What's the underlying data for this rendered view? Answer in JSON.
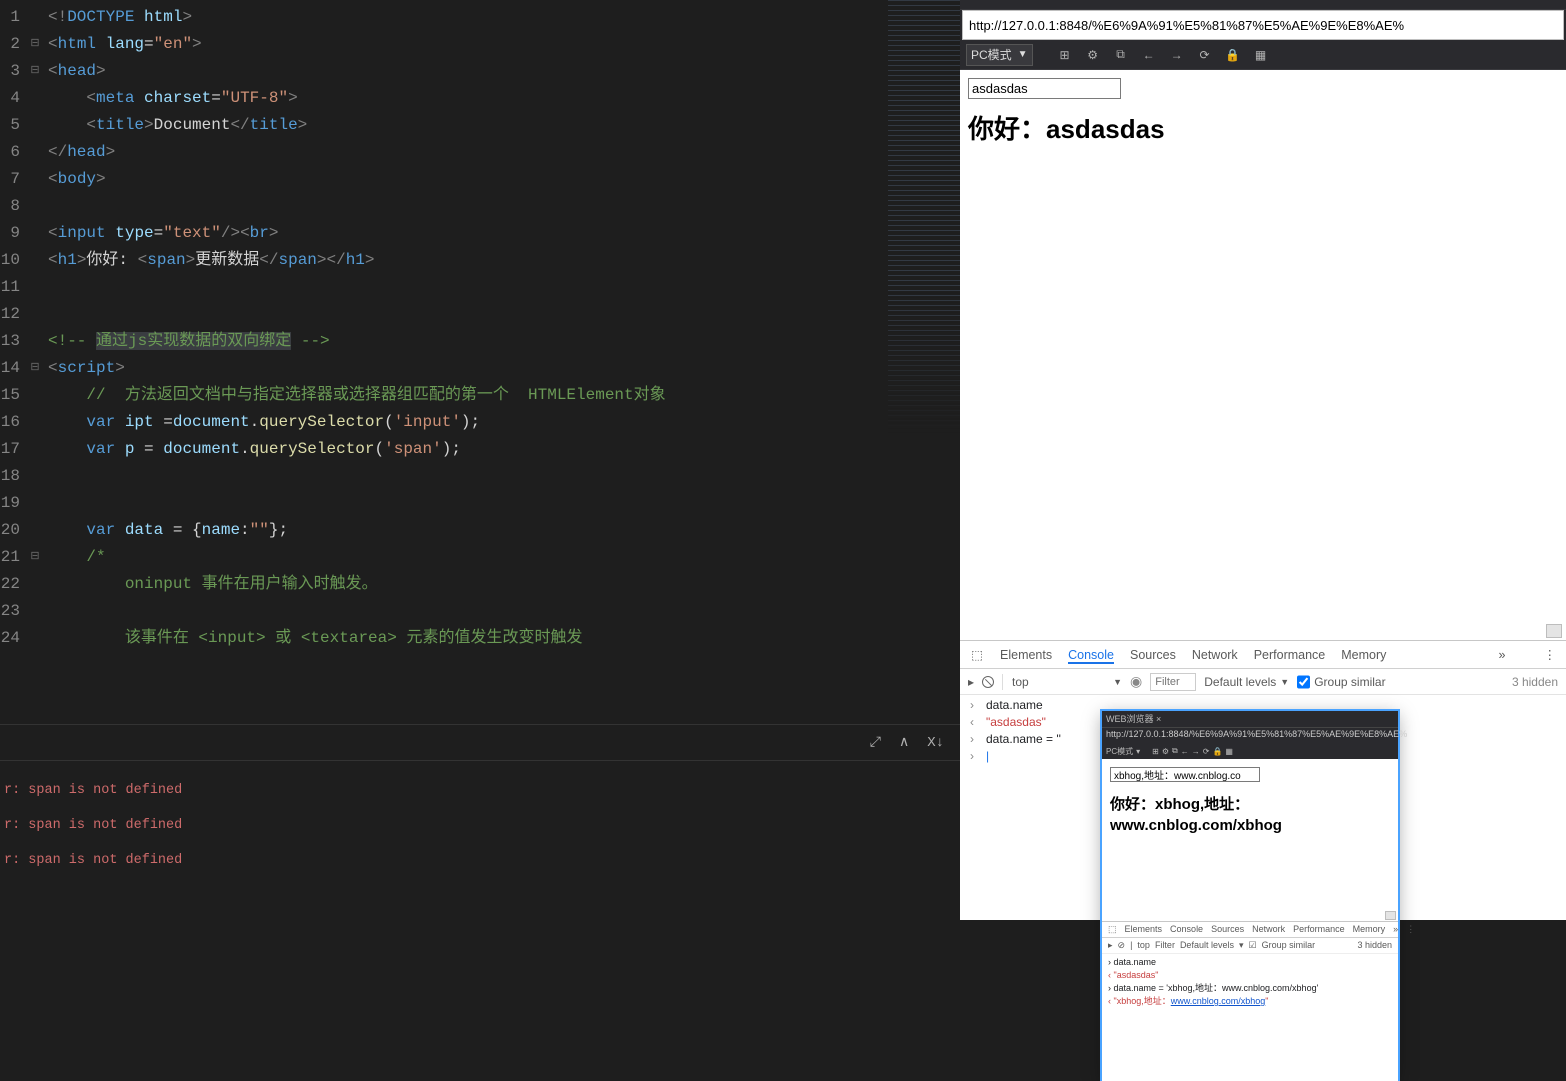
{
  "editor": {
    "lines": [
      {
        "num": 1,
        "fold": "",
        "html": "<span class='tk-gray'>&lt;!</span><span class='tk-tag'>DOCTYPE</span> <span class='tk-attr'>html</span><span class='tk-gray'>&gt;</span>"
      },
      {
        "num": 2,
        "fold": "⊟",
        "html": "<span class='tk-gray'>&lt;</span><span class='tk-tag'>html</span> <span class='tk-attr'>lang</span>=<span class='tk-str'>\"en\"</span><span class='tk-gray'>&gt;</span>"
      },
      {
        "num": 3,
        "fold": "⊟",
        "html": "<span class='tk-gray'>&lt;</span><span class='tk-tag'>head</span><span class='tk-gray'>&gt;</span>"
      },
      {
        "num": 4,
        "fold": "",
        "html": "    <span class='tk-gray'>&lt;</span><span class='tk-tag'>meta</span> <span class='tk-attr'>charset</span>=<span class='tk-str'>\"UTF-8\"</span><span class='tk-gray'>&gt;</span>"
      },
      {
        "num": 5,
        "fold": "",
        "html": "    <span class='tk-gray'>&lt;</span><span class='tk-tag'>title</span><span class='tk-gray'>&gt;</span><span class='tk-text'>Document</span><span class='tk-gray'>&lt;/</span><span class='tk-tag'>title</span><span class='tk-gray'>&gt;</span>"
      },
      {
        "num": 6,
        "fold": "",
        "html": "<span class='tk-gray'>&lt;/</span><span class='tk-tag'>head</span><span class='tk-gray'>&gt;</span>"
      },
      {
        "num": 7,
        "fold": "",
        "html": "<span class='tk-gray'>&lt;</span><span class='tk-tag'>body</span><span class='tk-gray'>&gt;</span>"
      },
      {
        "num": 8,
        "fold": "",
        "html": ""
      },
      {
        "num": 9,
        "fold": "",
        "html": "<span class='tk-gray'>&lt;</span><span class='tk-tag'>input</span> <span class='tk-attr'>type</span>=<span class='tk-str'>\"text\"</span><span class='tk-gray'>/&gt;&lt;</span><span class='tk-tag'>br</span><span class='tk-gray'>&gt;</span>"
      },
      {
        "num": 10,
        "fold": "",
        "html": "<span class='tk-gray'>&lt;</span><span class='tk-tag'>h1</span><span class='tk-gray'>&gt;</span><span class='tk-text'>你好:</span> <span class='tk-gray'>&lt;</span><span class='tk-tag'>span</span><span class='tk-gray'>&gt;</span><span class='tk-text'>更新数据</span><span class='tk-gray'>&lt;/</span><span class='tk-tag'>span</span><span class='tk-gray'>&gt;&lt;/</span><span class='tk-tag'>h1</span><span class='tk-gray'>&gt;</span>"
      },
      {
        "num": 11,
        "fold": "",
        "html": ""
      },
      {
        "num": 12,
        "fold": "",
        "html": ""
      },
      {
        "num": 13,
        "fold": "",
        "html": "<span class='tk-cm'>&lt;!-- </span><span class='tk-cmsel'>通过js实现数据的双向绑定</span><span class='tk-cm'> --&gt;</span>"
      },
      {
        "num": 14,
        "fold": "⊟",
        "html": "<span class='tk-gray'>&lt;</span><span class='tk-tag'>script</span><span class='tk-gray'>&gt;</span>"
      },
      {
        "num": 15,
        "fold": "",
        "html": "    <span class='tk-cm'>//  方法返回文档中与指定选择器或选择器组匹配的第一个  HTMLElement对象</span>"
      },
      {
        "num": 16,
        "fold": "",
        "html": "    <span class='tk-kw'>var</span> <span class='tk-var'>ipt</span> =<span class='tk-var'>document</span>.<span class='tk-fn'>querySelector</span>(<span class='tk-str'>'input'</span>);"
      },
      {
        "num": 17,
        "fold": "",
        "html": "    <span class='tk-kw'>var</span> <span class='tk-var'>p</span> = <span class='tk-var'>document</span>.<span class='tk-fn'>querySelector</span>(<span class='tk-str'>'span'</span>);"
      },
      {
        "num": 18,
        "fold": "",
        "html": ""
      },
      {
        "num": 19,
        "fold": "",
        "html": ""
      },
      {
        "num": 20,
        "fold": "",
        "html": "    <span class='tk-kw'>var</span> <span class='tk-var'>data</span> = {<span class='tk-var'>name</span>:<span class='tk-str'>\"\"</span>};"
      },
      {
        "num": 21,
        "fold": "⊟",
        "html": "    <span class='tk-cm'>/*</span>"
      },
      {
        "num": 22,
        "fold": "",
        "html": "        <span class='tk-cm'>oninput 事件在用户输入时触发。</span>"
      },
      {
        "num": 23,
        "fold": "",
        "html": ""
      },
      {
        "num": 24,
        "fold": "",
        "html": "        <span class='tk-cm'>该事件在 &lt;input&gt; 或 &lt;textarea&gt; 元素的值发生改变时触发</span>"
      }
    ]
  },
  "terminal": {
    "errors": [
      "r: span is not defined",
      "r: span is not defined",
      "r: span is not defined"
    ]
  },
  "statusbar": {
    "icons": [
      "⤢",
      "∧",
      "X↓"
    ]
  },
  "browser": {
    "url": "http://127.0.0.1:8848/%E6%9A%91%E5%81%87%E5%AE%9E%E8%AE%",
    "mode": "PC模式",
    "page": {
      "input_value": "asdasdas",
      "h1_prefix": "你好：",
      "h1_span": "asdasdas"
    },
    "toolbar_icons": [
      "⊞",
      "⚙",
      "⧉",
      "←",
      "→",
      "⟳",
      "🔒",
      "▦"
    ]
  },
  "devtools": {
    "tabs": [
      "Elements",
      "Console",
      "Sources",
      "Network",
      "Performance",
      "Memory"
    ],
    "active_tab": "Console",
    "toolbar": {
      "context": "top",
      "filter_placeholder": "Filter",
      "levels": "Default levels",
      "group_similar": "Group similar",
      "hidden": "3 hidden"
    },
    "console": [
      {
        "dir": "in",
        "text": "data.name"
      },
      {
        "dir": "out",
        "text": "\"asdasdas\""
      },
      {
        "dir": "in",
        "text": "data.name = ''"
      }
    ]
  },
  "preview": {
    "title": "WEB浏览器   ×",
    "url": "http://127.0.0.1:8848/%E6%9A%91%E5%81%87%E5%AE%9E%E8%AE%",
    "mode": "PC模式",
    "input_value": "xbhog,地址：www.cnblog.co",
    "h1_line1": "你好：xbhog,地址：",
    "h1_line2": "www.cnblog.com/xbhog",
    "devtools": {
      "tabs": [
        "Elements",
        "Console",
        "Sources",
        "Network",
        "Performance",
        "Memory"
      ],
      "toolbar": {
        "context": "top",
        "filter": "Filter",
        "levels": "Default levels",
        "group": "Group similar",
        "hidden": "3 hidden"
      },
      "console": [
        {
          "dir": "in",
          "text": "data.name"
        },
        {
          "dir": "out",
          "text": "\"asdasdas\""
        },
        {
          "dir": "in",
          "text": "data.name = 'xbhog,地址：www.cnblog.com/xbhog'"
        },
        {
          "dir": "out",
          "text": "\"xbhog,地址：",
          "link": "www.cnblog.com/xbhog",
          "tail": "\""
        }
      ]
    }
  }
}
